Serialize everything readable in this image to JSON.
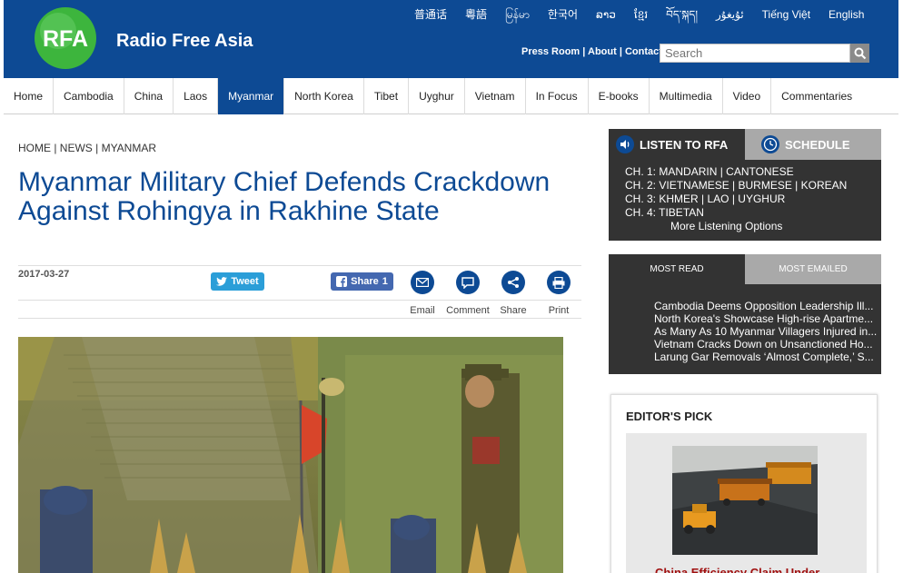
{
  "header": {
    "logo_text": "RFA",
    "site_name": "Radio Free Asia",
    "languages": [
      "普通话",
      "粵語",
      "မြန်မာ",
      "한국어",
      "ລາວ",
      "ខ្មែរ",
      "བོད་སྐད།",
      "ئۇيغۇر",
      "Tiếng Việt",
      "English"
    ],
    "util_links": [
      "Press Room",
      "About",
      "Contact"
    ],
    "search_placeholder": "Search"
  },
  "nav": {
    "items": [
      "Home",
      "Cambodia",
      "China",
      "Laos",
      "Myanmar",
      "North Korea",
      "Tibet",
      "Uyghur",
      "Vietnam",
      "In Focus",
      "E-books",
      "Multimedia",
      "Video",
      "Commentaries"
    ],
    "active": "Myanmar"
  },
  "article": {
    "breadcrumb": "HOME | NEWS | MYANMAR",
    "headline": "Myanmar Military Chief Defends Crackdown Against Rohingya in Rakhine State",
    "date": "2017-03-27",
    "tweet_label": "Tweet",
    "share_label": "Share",
    "share_count": "1",
    "tools": [
      "Email",
      "Comment",
      "Share",
      "Print"
    ]
  },
  "sidebar": {
    "listen_tab": "LISTEN TO RFA",
    "schedule_tab": "SCHEDULE",
    "channels": [
      {
        "prefix": "CH. 1:",
        "langs": "MANDARIN | CANTONESE"
      },
      {
        "prefix": "CH. 2:",
        "langs": "VIETNAMESE | BURMESE | KOREAN"
      },
      {
        "prefix": "CH. 3:",
        "langs": "KHMER | LAO | UYGHUR"
      },
      {
        "prefix": "CH. 4:",
        "langs": "TIBETAN"
      }
    ],
    "more_listening": "More Listening Options",
    "most_read_tab": "MOST READ",
    "most_emailed_tab": "MOST EMAILED",
    "most_read": [
      "Cambodia Deems Opposition Leadership Ill...",
      "North Korea's Showcase High-rise Apartme...",
      "As Many As 10 Myanmar Villagers Injured in...",
      "Vietnam Cracks Down on Unsanctioned Ho...",
      "Larung Gar Removals ‘Almost Complete,’ S..."
    ],
    "editors_pick_title": "EDITOR'S PICK",
    "editors_pick_caption": "China Efficiency Claim Under"
  },
  "colors": {
    "brand_blue": "#0d4a94",
    "sidebar_dark": "#333333",
    "tab_gray": "#a9a9a9",
    "tweet_blue": "#2b9ed8",
    "facebook_blue": "#4468b0",
    "caption_red": "#a01010"
  }
}
